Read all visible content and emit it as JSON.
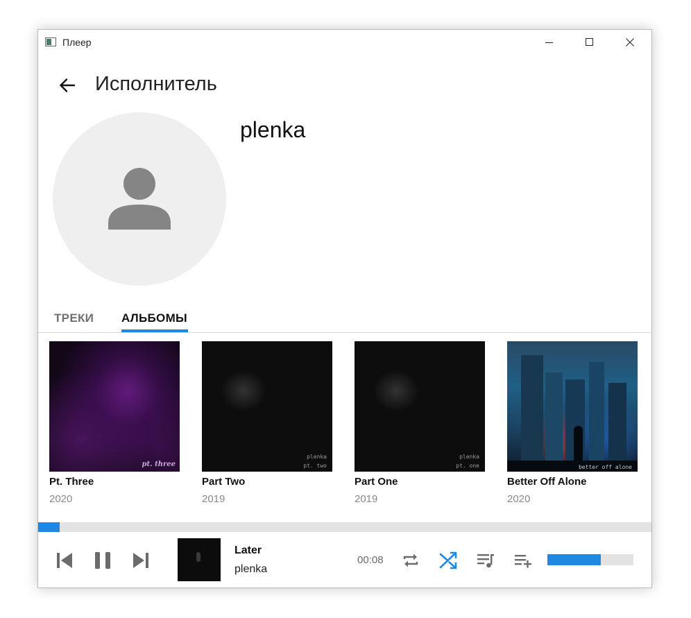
{
  "window": {
    "title": "Плеер",
    "icon": "app-window-icon"
  },
  "header": {
    "title": "Исполнитель",
    "back_icon": "arrow-left-icon"
  },
  "artist": {
    "name": "plenka",
    "avatar_icon": "person-icon"
  },
  "tabs": [
    {
      "label": "ТРЕКИ",
      "active": false
    },
    {
      "label": "АЛЬБОМЫ",
      "active": true
    }
  ],
  "albums": [
    {
      "title": "Pt. Three",
      "year": "2020",
      "cover_text": "pt. three"
    },
    {
      "title": "Part Two",
      "year": "2019",
      "cover_text_1": "plenka",
      "cover_text_2": "pt. two"
    },
    {
      "title": "Part One",
      "year": "2019",
      "cover_text_1": "plenka",
      "cover_text_2": "pt. one"
    },
    {
      "title": "Better Off Alone",
      "year": "2020",
      "cover_text": "better off alone"
    }
  ],
  "player": {
    "progress": 0.035,
    "track_title": "Later",
    "track_artist": "plenka",
    "time": "00:08",
    "volume": 0.62,
    "colors": {
      "accent": "#1e88e5",
      "icon": "#6b6b6b"
    },
    "controls": [
      "previous-icon",
      "pause-icon",
      "next-icon",
      "repeat-icon",
      "shuffle-icon",
      "queue-music-icon",
      "playlist-add-icon"
    ]
  }
}
